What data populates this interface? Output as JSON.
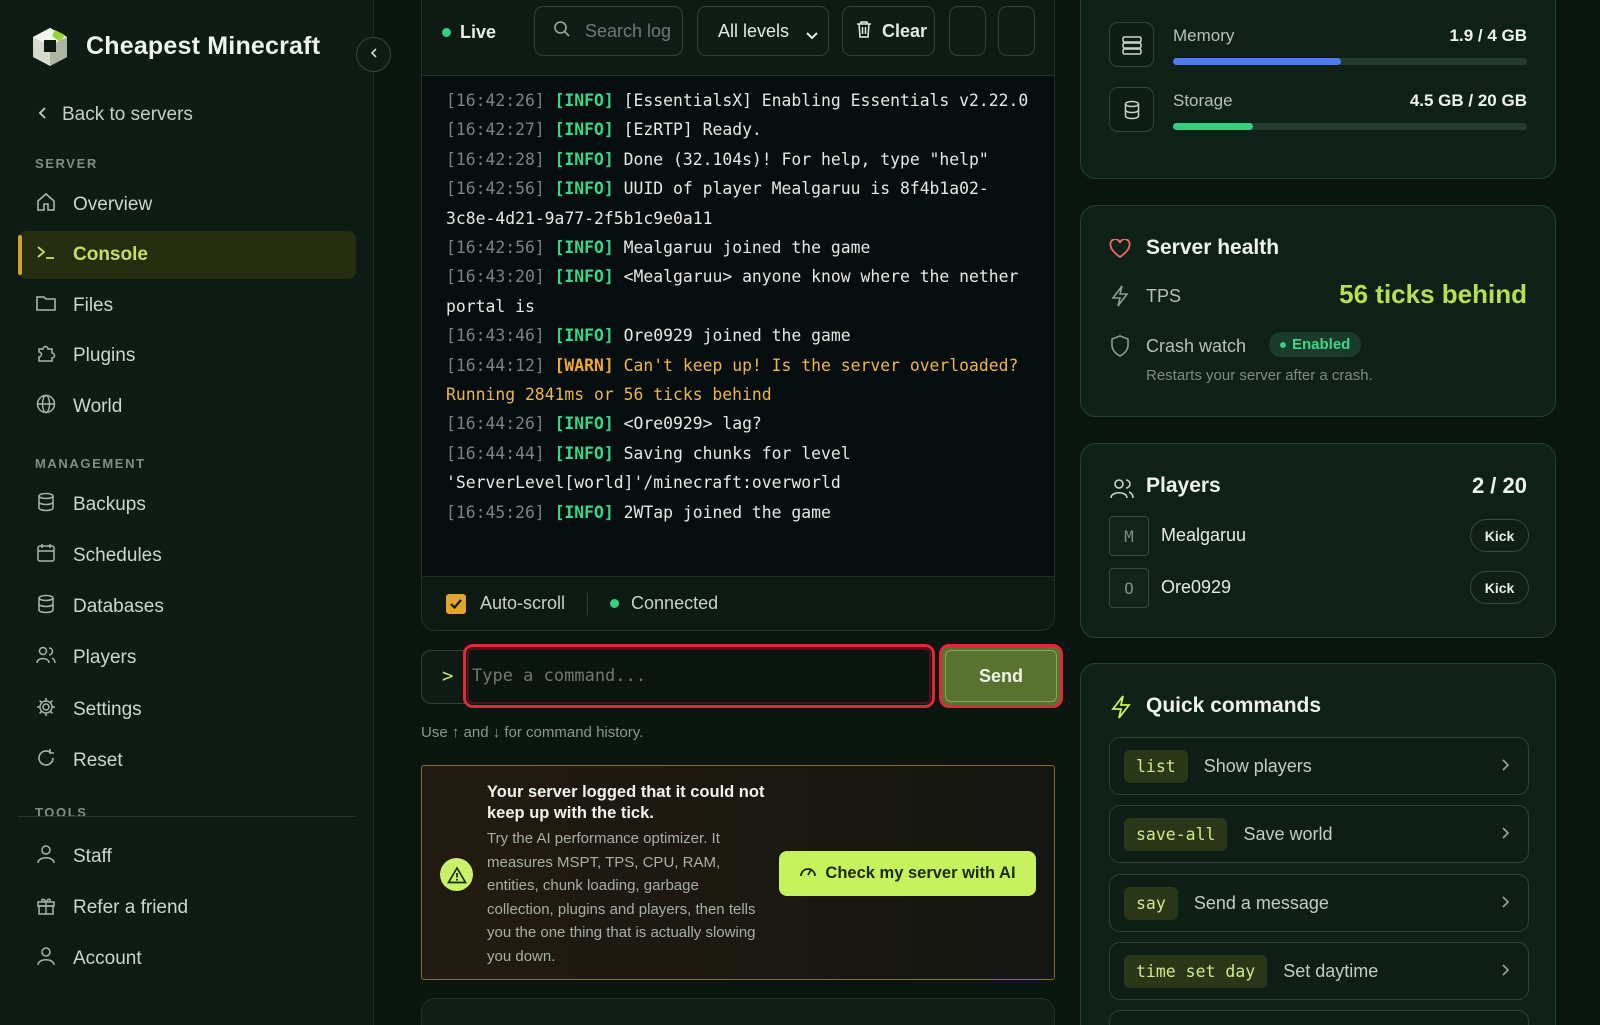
{
  "brand": {
    "name": "Cheapest Minecraft"
  },
  "sidebar": {
    "back_label": "Back to servers",
    "section_server": "SERVER",
    "section_management": "MANAGEMENT",
    "section_tools": "TOOLS",
    "items": [
      {
        "label": "Overview",
        "icon": "home-icon"
      },
      {
        "label": "Console",
        "icon": "terminal-icon",
        "active": true
      },
      {
        "label": "Files",
        "icon": "folder-icon"
      },
      {
        "label": "Plugins",
        "icon": "puzzle-icon"
      },
      {
        "label": "World",
        "icon": "globe-icon"
      },
      {
        "label": "Backups",
        "icon": "database-icon"
      },
      {
        "label": "Schedules",
        "icon": "calendar-icon"
      },
      {
        "label": "Databases",
        "icon": "database-icon"
      },
      {
        "label": "Players",
        "icon": "users-icon"
      },
      {
        "label": "Settings",
        "icon": "gear-icon"
      },
      {
        "label": "Reset",
        "icon": "reset-icon"
      },
      {
        "label": "Staff",
        "icon": "user-icon"
      },
      {
        "label": "Refer a friend",
        "icon": "gift-icon"
      },
      {
        "label": "Account",
        "icon": "user-icon"
      }
    ]
  },
  "console": {
    "live_label": "Live",
    "search_placeholder": "Search log",
    "level_selected": "All levels",
    "clear_label": "Clear",
    "lines": [
      {
        "ts": "[16:42:26]",
        "level": "[INFO]",
        "text": " [EssentialsX] Enabling Essentials v2.22.0"
      },
      {
        "ts": "[16:42:27]",
        "level": "[INFO]",
        "text": " [EzRTP] Ready."
      },
      {
        "ts": "[16:42:28]",
        "level": "[INFO]",
        "text": " Done (32.104s)! For help, type \"help\""
      },
      {
        "ts": "[16:42:56]",
        "level": "[INFO]",
        "text": " UUID of player Mealgaruu is 8f4b1a02-3c8e-4d21-9a77-2f5b1c9e0a11"
      },
      {
        "ts": "[16:42:56]",
        "level": "[INFO]",
        "text": " Mealgaruu joined the game"
      },
      {
        "ts": "[16:43:20]",
        "level": "[INFO]",
        "text": " <Mealgaruu> anyone know where the nether portal is"
      },
      {
        "ts": "[16:43:46]",
        "level": "[INFO]",
        "text": " Ore0929 joined the game"
      },
      {
        "ts": "[16:44:12]",
        "level": "[WARN]",
        "text": " Can't keep up! Is the server overloaded? Running 2841ms or 56 ticks behind"
      },
      {
        "ts": "[16:44:26]",
        "level": "[INFO]",
        "text": " <Ore0929> lag?"
      },
      {
        "ts": "[16:44:44]",
        "level": "[INFO]",
        "text": " Saving chunks for level 'ServerLevel[world]'/minecraft:overworld"
      },
      {
        "ts": "[16:45:26]",
        "level": "[INFO]",
        "text": " 2WTap joined the game"
      }
    ],
    "autoscroll_label": "Auto-scroll",
    "connected_label": "Connected",
    "prompt": ">",
    "command_placeholder": "Type a command...",
    "send_label": "Send",
    "hint": "Use ↑ and ↓ for command history."
  },
  "alert": {
    "title": "Your server logged that it could not keep up with the tick.",
    "body": "Try the AI performance optimizer. It measures MSPT, TPS, CPU, RAM, entities, chunk loading, garbage collection, plugins and players, then tells you the one thing that is actually slowing you down.",
    "button": "Check my server with AI"
  },
  "resources": {
    "memory": {
      "label": "Memory",
      "value": "1.9 / 4 GB",
      "fraction": 0.475,
      "color": "#4c7cf0"
    },
    "storage": {
      "label": "Storage",
      "value": "4.5 GB / 20 GB",
      "fraction": 0.225,
      "color": "#35d07f"
    }
  },
  "health": {
    "title": "Server health",
    "tps_label": "TPS",
    "tps_value": "56 ticks behind",
    "crash_label": "Crash watch",
    "crash_status": "Enabled",
    "crash_desc": "Restarts your server after a crash."
  },
  "players": {
    "title": "Players",
    "count": "2 / 20",
    "list": [
      {
        "initial": "M",
        "name": "Mealgaruu",
        "action": "Kick"
      },
      {
        "initial": "O",
        "name": "Ore0929",
        "action": "Kick"
      }
    ]
  },
  "quick": {
    "title": "Quick commands",
    "items": [
      {
        "code": "list",
        "desc": "Show players"
      },
      {
        "code": "save-all",
        "desc": "Save world"
      },
      {
        "code": "say",
        "desc": "Send a message"
      },
      {
        "code": "time set day",
        "desc": "Set daytime"
      }
    ]
  },
  "colors": {
    "accent": "#c6f25d",
    "danger": "#e0283a",
    "warn": "#f0a92d",
    "success": "#35d07f",
    "tps": "#c6f25d"
  }
}
